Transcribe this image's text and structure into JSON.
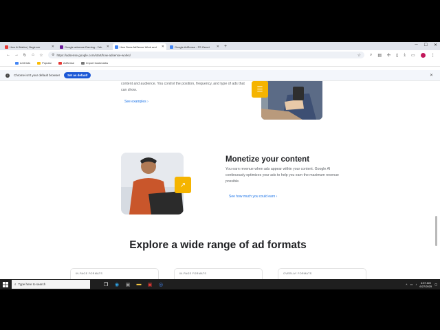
{
  "tabs": [
    {
      "title": "How AI Matter | Beginner",
      "favicon_color": "#e53935",
      "active": false
    },
    {
      "title": "Google adsense Earning - Yah",
      "favicon_color": "#6a1b9a",
      "active": false
    },
    {
      "title": "How Does AdSense Work and",
      "favicon_color": "#4285f4",
      "active": true
    },
    {
      "title": "Google AdSense - FS Genet",
      "favicon_color": "#4285f4",
      "active": false
    }
  ],
  "toolbar": {
    "url": "https://adsense.google.com/start/how-adsense-works/"
  },
  "bookmarks": [
    {
      "label": "AI 8 lists",
      "color": "#4285f4"
    },
    {
      "label": "Popular",
      "color": "#fbbc04"
    },
    {
      "label": "AdSense",
      "color": "#e53935"
    },
    {
      "label": "Import bookmarks",
      "color": "#777777"
    }
  ],
  "default_bar": {
    "message": "Chrome isn't your default browser",
    "button": "Set as default"
  },
  "section1": {
    "text": "content and audience. You control the position, frequency, and type of ads that can show.",
    "link": "See examples"
  },
  "section2": {
    "title": "Monetize your content",
    "text": "You earn revenue when ads appear within your content. Google AI continuously optimizes your ads to help you earn the maximum revenue possible.",
    "link": "See how much you could earn"
  },
  "explore_heading": "Explore a wide range of ad formats",
  "cards": [
    {
      "label": "IN-PAGE FORMATS"
    },
    {
      "label": "IN-PAGE FORMATS"
    },
    {
      "label": "OVERLAY FORMATS"
    }
  ],
  "taskbar": {
    "search_placeholder": "Type here to search",
    "time": "4:57 AM",
    "date": "6/27/2025"
  },
  "colors": {
    "accent_link": "#1a73e8",
    "badge": "#f5b400",
    "set_default_button": "#1a57d6"
  }
}
